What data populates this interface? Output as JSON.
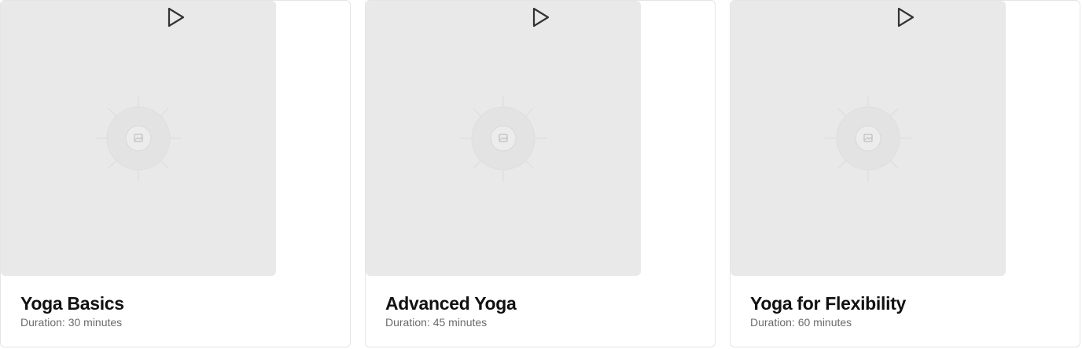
{
  "courses": [
    {
      "title": "Yoga Basics",
      "duration": "Duration: 30 minutes"
    },
    {
      "title": "Advanced Yoga",
      "duration": "Duration: 45 minutes"
    },
    {
      "title": "Yoga for Flexibility",
      "duration": "Duration: 60 minutes"
    }
  ],
  "icons": {
    "play": "play-icon",
    "thumbnail": "image-placeholder-icon"
  },
  "colors": {
    "thumbnail_bg": "#e9e9e9",
    "title": "#111111",
    "meta": "#6b6b6b",
    "border": "#e5e5e5"
  }
}
